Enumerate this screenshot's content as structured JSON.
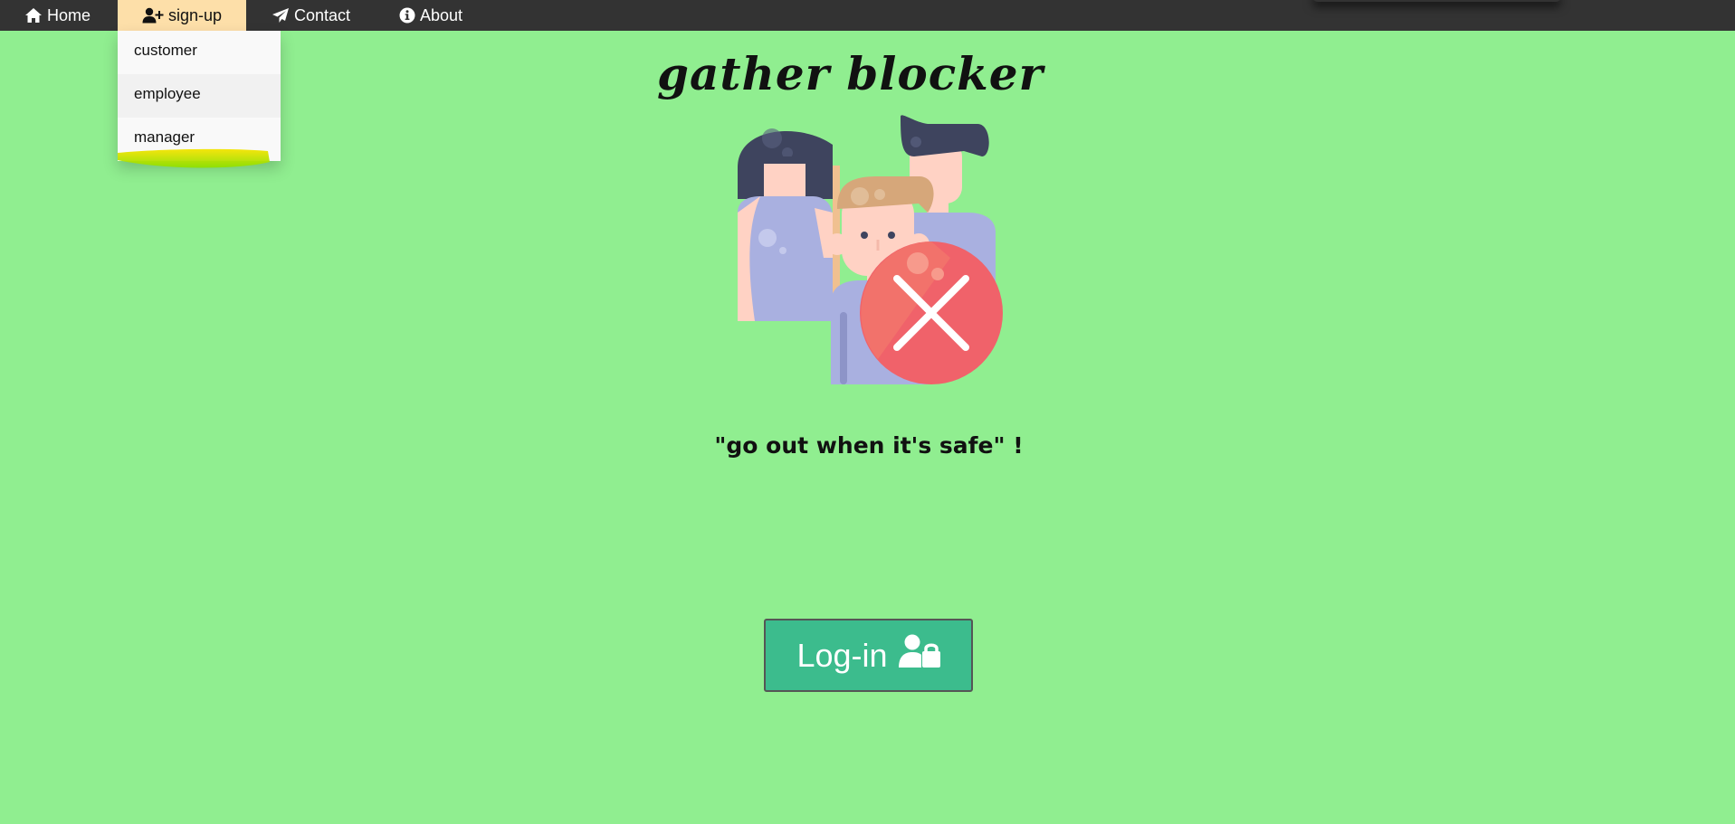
{
  "nav": {
    "home_label": "Home",
    "signup_label": "sign-up",
    "contact_label": "Contact",
    "about_label": "About",
    "active_item": "sign-up",
    "active_bg": "#fddfa9",
    "bar_bg": "#333333"
  },
  "signup_dropdown": {
    "items": [
      {
        "label": "customer"
      },
      {
        "label": "employee",
        "hovered": true
      },
      {
        "label": "manager"
      }
    ]
  },
  "main": {
    "brand_title": "gather blocker",
    "slogan": "\"go out when it's safe\" !",
    "login_label": "Log-in",
    "login_color": "#3cbc8d",
    "background": "#90ee90"
  },
  "icons": {
    "home": "home-icon",
    "signup": "user-plus-icon",
    "contact": "paper-plane-icon",
    "about": "info-circle-icon",
    "login": "user-lock-icon",
    "illustration": "people-blocked-illustration"
  }
}
